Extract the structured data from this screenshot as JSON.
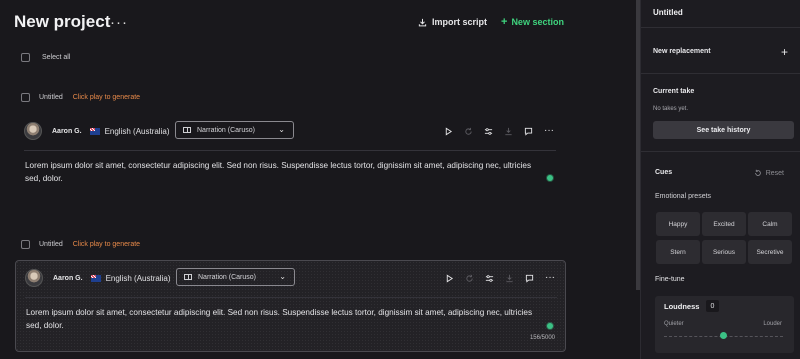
{
  "header": {
    "title": "New project",
    "more_icon": "ellipsis-icon",
    "import_label": "Import script",
    "new_section_label": "New section"
  },
  "select_all_label": "Select all",
  "sections": [
    {
      "name": "Untitled",
      "generate_label": "Click play to generate",
      "speaker": "Aaron G.",
      "language": "English (Australia)",
      "model": "Narration (Caruso)",
      "text": "Lorem ipsum dolor sit amet, consectetur adipiscing elit. Sed non risus. Suspendisse lectus tortor, dignissim sit amet, adipiscing nec, ultricies sed, dolor.",
      "char_count": ""
    },
    {
      "name": "Untitled",
      "generate_label": "Click play to generate",
      "speaker": "Aaron G.",
      "language": "English (Australia)",
      "model": "Narration (Caruso)",
      "text": "Lorem ipsum dolor sit amet, consectetur adipiscing elit. Sed non risus. Suspendisse lectus tortor, dignissim sit amet, adipiscing nec, ultricies sed, dolor.",
      "char_count": "156/5000"
    }
  ],
  "side": {
    "title": "Untitled",
    "new_replacement": "New replacement",
    "current_take": "Current take",
    "no_takes": "No takes yet.",
    "see_history": "See take history",
    "cues": "Cues",
    "reset": "Reset",
    "emotional_presets": "Emotional presets",
    "presets": [
      "Happy",
      "Excited",
      "Calm",
      "Stern",
      "Serious",
      "Secretive"
    ],
    "fine_tune": "Fine-tune",
    "loudness_label": "Loudness",
    "loudness_value": "0",
    "quieter": "Quieter",
    "louder": "Louder",
    "loudness_level": 0.5
  },
  "colors": {
    "accent": "#3fd47e",
    "generate": "#e88a4a",
    "status_dot": "#3bc185"
  }
}
